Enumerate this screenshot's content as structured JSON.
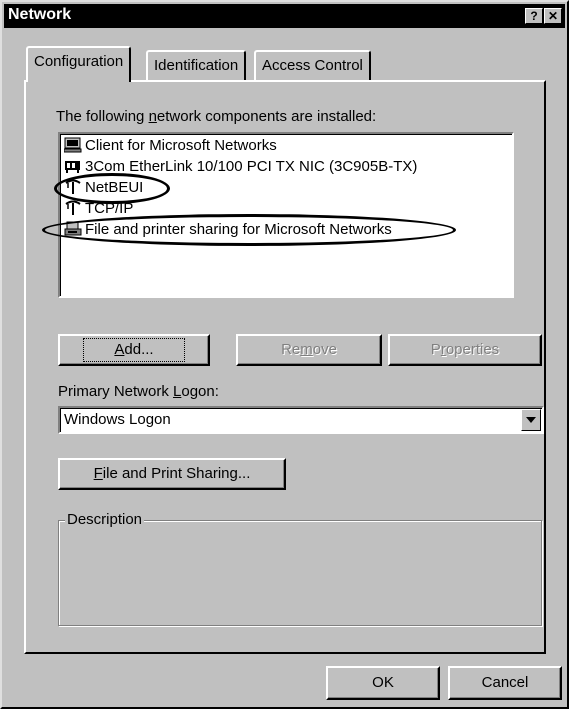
{
  "window": {
    "title": "Network",
    "help_glyph": "?",
    "close_glyph": "✕"
  },
  "tabs": [
    {
      "label": "Configuration",
      "active": true
    },
    {
      "label": "Identification",
      "active": false
    },
    {
      "label": "Access Control",
      "active": false
    }
  ],
  "components": {
    "label_pre": "The following ",
    "label_accel": "n",
    "label_post": "etwork components are installed:",
    "items": [
      {
        "label": "Client for Microsoft Networks",
        "icon": "client-icon",
        "circled": false
      },
      {
        "label": "3Com EtherLink 10/100 PCI TX NIC (3C905B-TX)",
        "icon": "network-adapter-icon",
        "circled": false
      },
      {
        "label": "NetBEUI",
        "icon": "protocol-icon",
        "circled": true
      },
      {
        "label": "TCP/IP",
        "icon": "protocol-icon",
        "circled": false
      },
      {
        "label": "File and printer sharing for Microsoft Networks",
        "icon": "service-icon",
        "circled": true
      }
    ]
  },
  "buttons": {
    "add": {
      "accel": "A",
      "rest": "dd..."
    },
    "remove": {
      "pre": "Re",
      "accel": "m",
      "post": "ove"
    },
    "properties": {
      "pre": "P",
      "accel": "r",
      "post": "operties"
    }
  },
  "logon": {
    "label_pre": "Primary Network ",
    "label_accel": "L",
    "label_post": "ogon:",
    "value": "Windows Logon"
  },
  "file_print": {
    "accel": "F",
    "rest": "ile and Print Sharing..."
  },
  "description": {
    "legend": "Description"
  },
  "footer": {
    "ok": "OK",
    "cancel": "Cancel"
  }
}
